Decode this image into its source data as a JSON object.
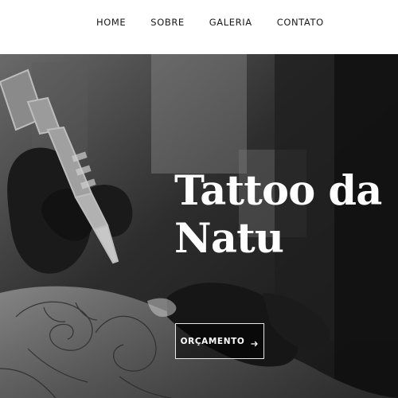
{
  "nav": {
    "items": [
      {
        "label": "HOME"
      },
      {
        "label": "SOBRE"
      },
      {
        "label": "GALERIA"
      },
      {
        "label": "CONTATO"
      }
    ]
  },
  "hero": {
    "title": "Tattoo da Natu",
    "cta_label": "ORÇAMENTO",
    "cta_icon": "arrow-right-icon",
    "image": "tattoo-artist-working-photo"
  },
  "colors": {
    "nav_background": "#ffffff",
    "nav_text": "#1a1a1a",
    "hero_text": "#ffffff",
    "hero_image_tone": "grayscale"
  }
}
